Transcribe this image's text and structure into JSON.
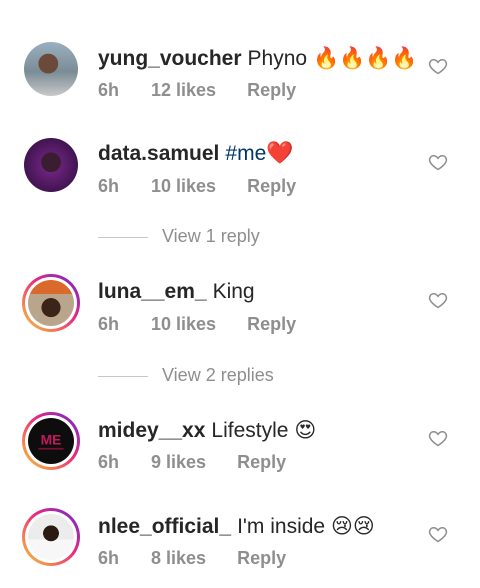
{
  "comments": [
    {
      "username": "yung_voucher",
      "text": "Phyno",
      "emoji": "🔥🔥🔥🔥",
      "time": "6h",
      "likes": "12 likes",
      "reply": "Reply"
    },
    {
      "username": "data.samuel",
      "text": "#me",
      "emoji": "❤️",
      "time": "6h",
      "likes": "10 likes",
      "reply": "Reply",
      "view_replies": "View 1 reply"
    },
    {
      "username": "luna__em_",
      "text": "King",
      "emoji": "",
      "time": "6h",
      "likes": "10 likes",
      "reply": "Reply",
      "view_replies": "View 2 replies"
    },
    {
      "username": "midey__xx",
      "text": "Lifestyle",
      "emoji": "😍",
      "time": "6h",
      "likes": "9 likes",
      "reply": "Reply"
    },
    {
      "username": "nlee_official_",
      "text": "I'm inside",
      "emoji": "😢😢",
      "time": "6h",
      "likes": "8 likes",
      "reply": "Reply"
    }
  ],
  "icons": {
    "like": "heart-outline-icon"
  },
  "colors": {
    "username": "#262626",
    "meta": "#8e8e8e",
    "hashtag": "#00376b",
    "story_ring_start": "#f9ce34",
    "story_ring_mid": "#ee2a7b",
    "story_ring_end": "#6228d7"
  }
}
